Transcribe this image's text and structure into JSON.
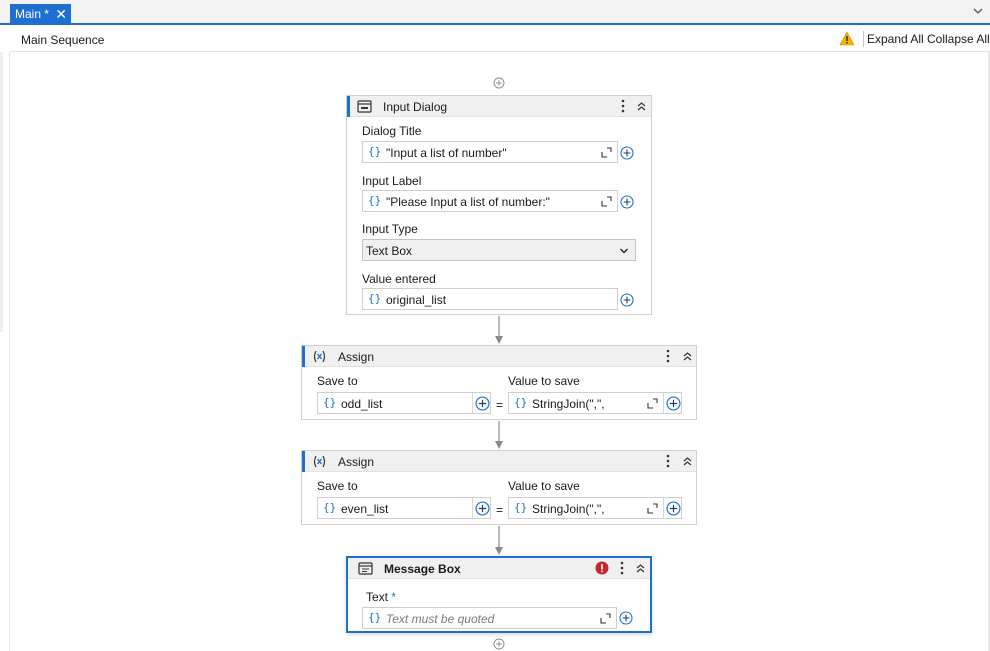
{
  "tabs": [
    {
      "label": "Main *"
    }
  ],
  "header": {
    "title": "Main Sequence",
    "expand_all": "Expand All",
    "collapse_all": "Collapse All"
  },
  "input_dialog": {
    "name": "Input Dialog",
    "dialog_title_label": "Dialog Title",
    "dialog_title_value": "\"Input a list of number\"",
    "input_label_label": "Input Label",
    "input_label_value": "\"Please Input a list of number:\"",
    "input_type_label": "Input Type",
    "input_type_value": "Text Box",
    "value_entered_label": "Value entered",
    "value_entered_value": "original_list"
  },
  "assign1": {
    "name": "Assign",
    "save_to_label": "Save to",
    "save_to_value": "odd_list",
    "value_label": "Value to save",
    "value_value": "StringJoin(\",\",",
    "eq": "="
  },
  "assign2": {
    "name": "Assign",
    "save_to_label": "Save to",
    "save_to_value": "even_list",
    "value_label": "Value to save",
    "value_value": "StringJoin(\",\",",
    "eq": "="
  },
  "message_box": {
    "name": "Message Box",
    "text_label": "Text",
    "required_mark": "*",
    "text_placeholder": "Text must be quoted"
  },
  "glyphs": {
    "braces": "{}",
    "close": "✕"
  },
  "colors": {
    "accent": "#1f6fd1",
    "warning": "#f5b400",
    "error": "#c4262e"
  }
}
